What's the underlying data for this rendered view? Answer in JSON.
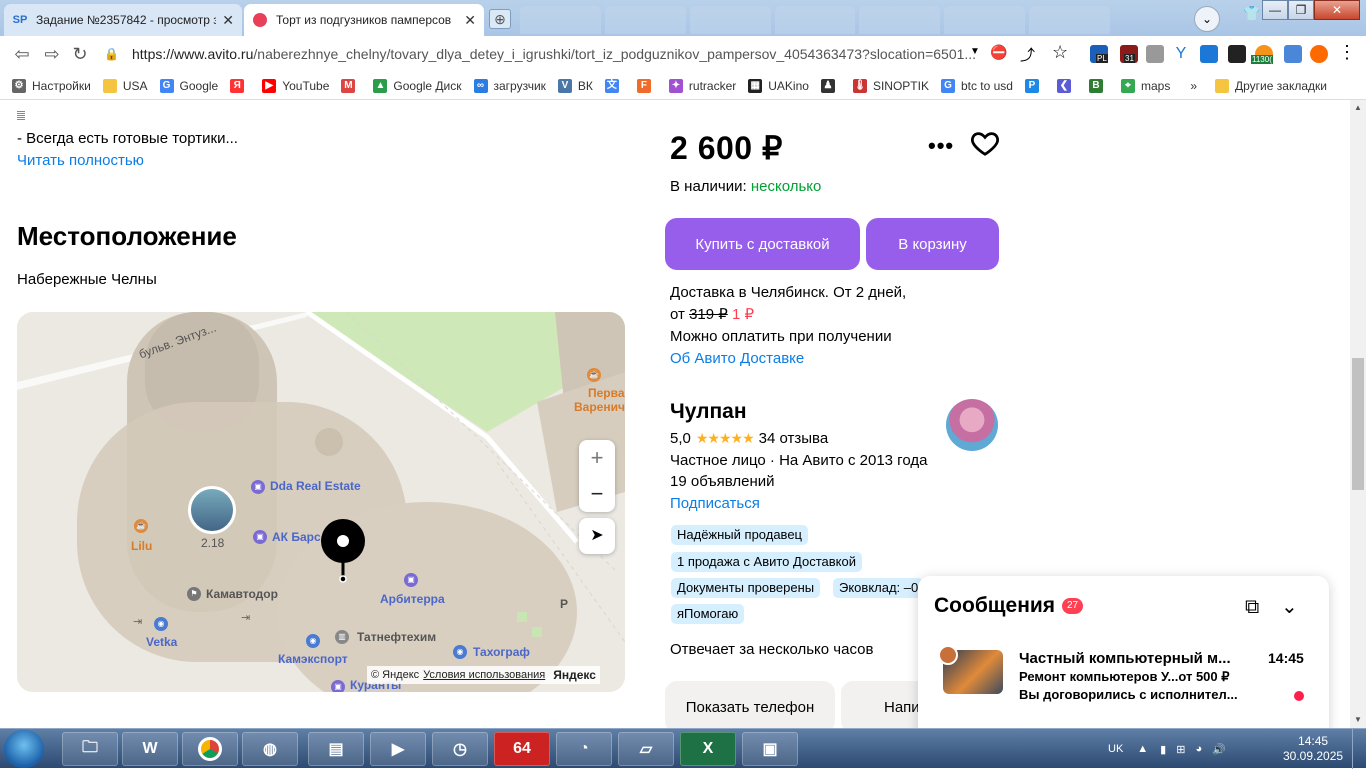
{
  "browser": {
    "tabs": [
      {
        "title": "Задание №2357842 - просмотр з",
        "favicon": "SP"
      },
      {
        "title": "Торт из подгузников памперсов",
        "favicon": "avito"
      }
    ],
    "address": {
      "url_host": "https://www.avito.ru",
      "url_path": "/naberezhnye_chelny/tovary_dlya_detey_i_igrushki/tort_iz_podguznikov_pampersov_4054363473?slocation=6501..."
    },
    "badges": {
      "pl": "PL",
      "cal": "31",
      "btc": "1130("
    }
  },
  "bookmarks": [
    {
      "label": "Настройки",
      "icon": "gear-icon"
    },
    {
      "label": "USA",
      "icon": "folder-icon"
    },
    {
      "label": "Google",
      "icon": "google-icon"
    },
    {
      "label": "",
      "icon": "yandex-icon"
    },
    {
      "label": "YouTube",
      "icon": "youtube-icon"
    },
    {
      "label": "",
      "icon": "gmail-icon"
    },
    {
      "label": "Google Диск",
      "icon": "drive-icon"
    },
    {
      "label": "загрузчик",
      "icon": "infinity-icon"
    },
    {
      "label": "ВК",
      "icon": "vk-icon"
    },
    {
      "label": "",
      "icon": "translate-icon"
    },
    {
      "label": "",
      "icon": "f-icon"
    },
    {
      "label": "rutracker",
      "icon": "rutracker-icon"
    },
    {
      "label": "UAKino",
      "icon": "film-icon"
    },
    {
      "label": "",
      "icon": "person-icon"
    },
    {
      "label": "SINOPTIK",
      "icon": "thermometer-icon"
    },
    {
      "label": "btc to usd",
      "icon": "google-icon"
    },
    {
      "label": "",
      "icon": "p-icon"
    },
    {
      "label": "",
      "icon": "arrow-icon"
    },
    {
      "label": "",
      "icon": "bc-icon"
    },
    {
      "label": "maps",
      "icon": "maps-icon"
    }
  ],
  "bookmarks_more": "»",
  "bookmarks_other": "Другие закладки",
  "listing": {
    "desc_snippet": "- Всегда есть готовые тортики...",
    "read_more": "Читать полностью",
    "location_title": "Местоположение",
    "city": "Набережные Челны",
    "price": "2 600 ₽",
    "stock_label": "В наличии:",
    "stock_value": "несколько",
    "buy_button": "Купить с доставкой",
    "cart_button": "В корзину",
    "delivery_line1": "Доставка в Челябинск. От 2 дней,",
    "delivery_from": "от",
    "delivery_old_price": "319 ₽",
    "delivery_new_price": "1 ₽",
    "pay_on_receive": "Можно оплатить при получении",
    "about_delivery": "Об Авито Доставке"
  },
  "map": {
    "labels": {
      "street": "бульв. Энтуз...",
      "dda": "Dda Real Estate",
      "ak": "АК Барс",
      "kamavtodor": "Камавтодор",
      "arbiterra": "Арбитерра",
      "lilu": "Lilu",
      "vetka": "Vetka",
      "tatneft": "Татнефтехим",
      "kamexport": "Камэкспорт",
      "tachograph": "Тахограф",
      "kuranty": "Куранты",
      "pervaya": "Перва",
      "varenich": "Варенич",
      "building_num": "2.18",
      "p_mark": "P"
    },
    "zoom_in": "+",
    "zoom_out": "−",
    "copyright": "© Яндекс",
    "terms": "Условия использования",
    "logo": "Яндекс"
  },
  "seller": {
    "name": "Чулпан",
    "rating": "5,0",
    "stars": "★★★★★",
    "reviews": "34 отзыва",
    "type": "Частное лицо · На Авито с 2013 года",
    "ads": "19 объявлений",
    "subscribe": "Подписаться",
    "badges": [
      "Надёжный продавец",
      "1 продажа с Авито Доставкой",
      "Документы проверены",
      "Эковклад: –0",
      "яПомогаю"
    ],
    "answers": "Отвечает за несколько часов",
    "show_phone": "Показать телефон",
    "write": "Напи"
  },
  "messages": {
    "title": "Сообщения",
    "count": "27",
    "item": {
      "title": "Частный компьютерный м...",
      "subtitle": "Ремонт компьютеров У...от 500 ₽",
      "preview": "Вы договорились с исполнител...",
      "time": "14:45"
    }
  },
  "taskbar": {
    "lang": "UK",
    "time": "14:45",
    "date": "30.09.2025",
    "app64": "64"
  },
  "colors": {
    "accent": "#965eeb",
    "link": "#0a7ee6",
    "green": "#02a035",
    "red": "#ff4053",
    "badge": "#d6efff"
  }
}
